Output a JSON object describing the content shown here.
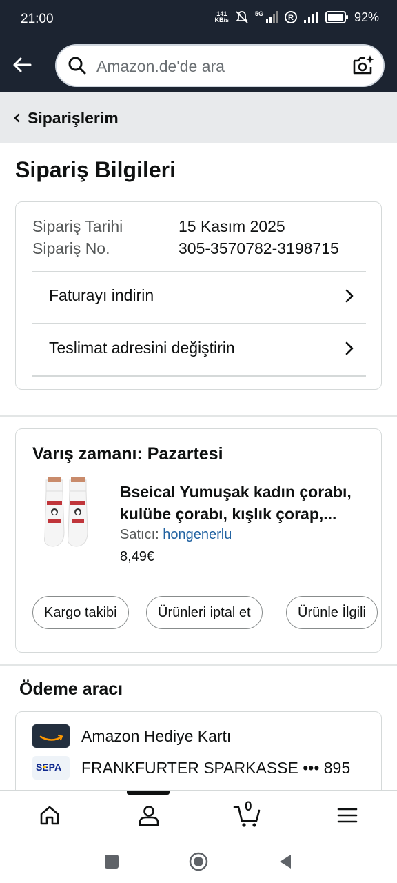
{
  "status_bar": {
    "time": "21:00",
    "net_speed_top": "141",
    "net_speed_bottom": "KB/s",
    "battery": "92%",
    "icons": [
      "mute-icon",
      "5g-signal-icon",
      "registered-icon",
      "signal-icon",
      "battery-icon"
    ]
  },
  "header": {
    "search_placeholder": "Amazon.de'de ara",
    "icons": [
      "back-arrow-icon",
      "search-icon",
      "camera-icon"
    ]
  },
  "breadcrumb": {
    "label": "Siparişlerim"
  },
  "page": {
    "title": "Sipariş Bilgileri"
  },
  "order_info": {
    "date_label": "Sipariş Tarihi",
    "date_value": "15 Kasım 2025",
    "number_label": "Sipariş No.",
    "number_value": "305-3570782-3198715",
    "links": [
      {
        "label": "Faturayı indirin"
      },
      {
        "label": "Teslimat adresini değiştirin"
      }
    ]
  },
  "shipment": {
    "arrival": "Varış zamanı: Pazartesi",
    "product_title_line1": "Bseical Yumuşak kadın çorabı,",
    "product_title_line2": "kulübe çorabı, kışlık çorap,...",
    "seller_label": "Satıcı:",
    "seller_name": "hongenerlu",
    "price": "8,49€",
    "actions": [
      "Kargo takibi",
      "Ürünleri iptal et",
      "Ürünle İlgili"
    ]
  },
  "payment": {
    "title": "Ödeme aracı",
    "methods": [
      {
        "label": "Amazon Hediye Kartı",
        "logo": "amazon-gift-card-logo"
      },
      {
        "label": "FRANKFURTER SPARKASSE ••• 895",
        "logo": "sepa-logo",
        "logo_text": "SEPA"
      }
    ]
  },
  "bottom_nav": {
    "cart_count": "0",
    "items": [
      "home-icon",
      "account-icon",
      "cart-icon",
      "menu-icon"
    ]
  },
  "colors": {
    "header_bg": "#1c2431",
    "link": "#2162a1",
    "breadcrumb_bg": "#e8eaec",
    "amazon_orange": "#ff9900"
  }
}
